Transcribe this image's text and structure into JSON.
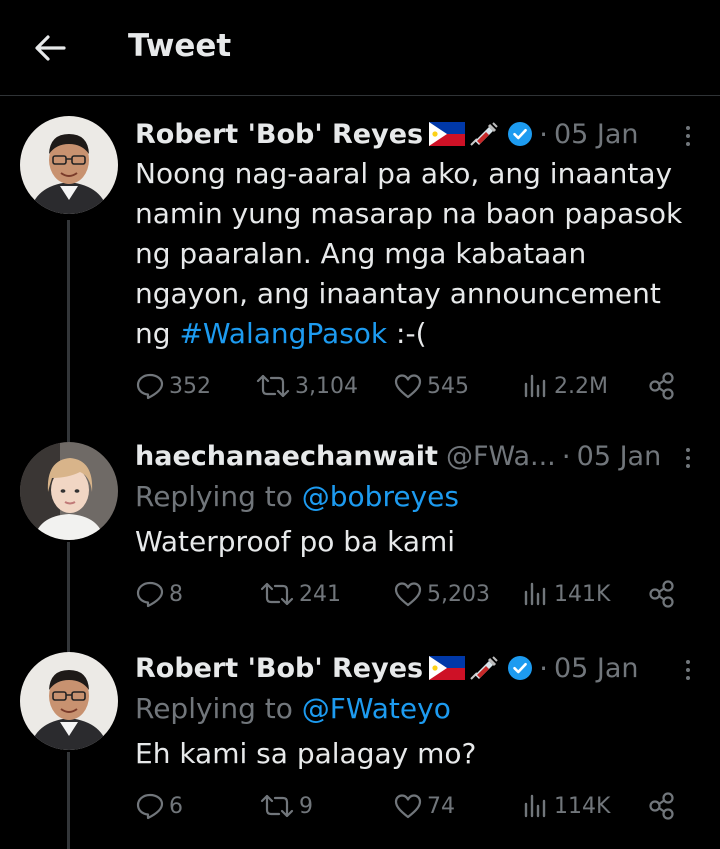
{
  "header": {
    "title": "Tweet"
  },
  "tweets": [
    {
      "name": "Robert 'Bob' Reyes",
      "handle": "",
      "date": "05 Jan",
      "text_main": "Noong nag-aaral pa ako, ang inaantay namin yung masarap na baon papasok ng paaralan. Ang mga kabataan ngayon, ang inaantay announcement ng",
      "hashtag": "#WalangPasok",
      "text_tail": " :-(",
      "replies": "352",
      "retweets": "3,104",
      "likes": "545",
      "views": "2.2M"
    },
    {
      "name": "haechanaechanwait",
      "handle": "@FWa...",
      "date": "05 Jan",
      "replying_prefix": "Replying to ",
      "replying_to": "@bobreyes",
      "text": "Waterproof po ba kami",
      "replies": "8",
      "retweets": "241",
      "likes": "5,203",
      "views": "141K"
    },
    {
      "name": "Robert 'Bob' Reyes",
      "handle": "",
      "date": "05 Jan",
      "replying_prefix": "Replying to ",
      "replying_to": "@FWateyo",
      "text": "Eh kami sa palagay mo?",
      "replies": "6",
      "retweets": "9",
      "likes": "74",
      "views": "114K"
    }
  ],
  "colors": {
    "link": "#1d9bf0",
    "muted": "#71767b",
    "text": "#e7e9ea",
    "background": "#000000"
  },
  "icons": [
    "back-arrow-icon",
    "philippines-flag-icon",
    "syringe-icon",
    "verified-badge-icon",
    "more-icon",
    "reply-icon",
    "retweet-icon",
    "like-icon",
    "views-icon",
    "share-icon"
  ]
}
